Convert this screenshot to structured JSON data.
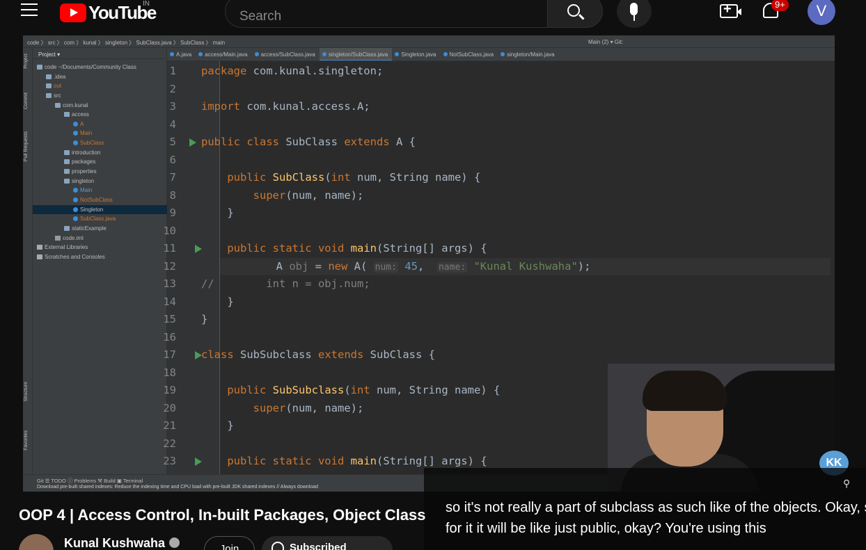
{
  "youtube": {
    "logo": "YouTube",
    "country": "IN",
    "search_placeholder": "Search",
    "notifications_badge": "9+",
    "avatar_letter": "V"
  },
  "ide": {
    "breadcrumb": "code 〉 src 〉 com 〉 kunal 〉 singleton 〉 SubClass.java 〉 SubClass 〉 main",
    "toolbar_right": "Main (2) ▾        Git:",
    "project_label": "Project ▾",
    "tree": [
      {
        "label": "code  ~/Documents/Community Class",
        "depth": 0,
        "type": "folder"
      },
      {
        "label": ".idea",
        "depth": 1,
        "type": "folder"
      },
      {
        "label": "out",
        "depth": 1,
        "type": "folder",
        "color": "#c87832"
      },
      {
        "label": "src",
        "depth": 1,
        "type": "folder"
      },
      {
        "label": "com.kunal",
        "depth": 2,
        "type": "folder"
      },
      {
        "label": "access",
        "depth": 3,
        "type": "folder"
      },
      {
        "label": "A",
        "depth": 4,
        "type": "class",
        "color": "#c87832"
      },
      {
        "label": "Main",
        "depth": 4,
        "type": "class",
        "color": "#c87832"
      },
      {
        "label": "SubClass",
        "depth": 4,
        "type": "class",
        "color": "#c87832"
      },
      {
        "label": "introduction",
        "depth": 3,
        "type": "folder"
      },
      {
        "label": "packages",
        "depth": 3,
        "type": "folder"
      },
      {
        "label": "properties",
        "depth": 3,
        "type": "folder"
      },
      {
        "label": "singleton",
        "depth": 3,
        "type": "folder"
      },
      {
        "label": "Main",
        "depth": 4,
        "type": "class",
        "color": "#6897bb"
      },
      {
        "label": "NotSubClass",
        "depth": 4,
        "type": "class",
        "color": "#c87832"
      },
      {
        "label": "Singleton",
        "depth": 4,
        "type": "class",
        "color": "#bbbbbb",
        "selected": true
      },
      {
        "label": "SubClass.java",
        "depth": 4,
        "type": "class",
        "color": "#c87832"
      },
      {
        "label": "staticExample",
        "depth": 3,
        "type": "folder"
      },
      {
        "label": "code.iml",
        "depth": 2,
        "type": "file"
      },
      {
        "label": "External Libraries",
        "depth": 0,
        "type": "lib"
      },
      {
        "label": "Scratches and Consoles",
        "depth": 0,
        "type": "lib"
      }
    ],
    "tabs": [
      {
        "label": "A.java"
      },
      {
        "label": "access/Main.java"
      },
      {
        "label": "access/SubClass.java"
      },
      {
        "label": "singleton/SubClass.java",
        "active": true
      },
      {
        "label": "Singleton.java"
      },
      {
        "label": "NotSubClass.java"
      },
      {
        "label": "singleton/Main.java"
      }
    ],
    "left_strip": [
      "Project",
      "Commit",
      "Pull Requests",
      "Structure",
      "Favorites"
    ],
    "bottom_tools": "Git     ☰ TODO     ⓘ Problems     ⚒ Build     ▣ Terminal",
    "status_message": "Download pre-built shared indexes: Reduce the indexing time and CPU load with pre-built JDK shared indexes // Always download",
    "code_lines": [
      {
        "n": "1",
        "html": "<span class=\"kw\">package</span> com.kunal.singleton;"
      },
      {
        "n": "2",
        "html": ""
      },
      {
        "n": "3",
        "html": "<span class=\"kw\">import</span> com.kunal.access.A;"
      },
      {
        "n": "4",
        "html": ""
      },
      {
        "n": "5",
        "html": "<span class=\"kw\">public class</span> SubClass <span class=\"kw\">extends</span> A {",
        "run": true
      },
      {
        "n": "6",
        "html": ""
      },
      {
        "n": "7",
        "html": "    <span class=\"kw\">public</span> <span class=\"fn\">SubClass</span>(<span class=\"kw\">int</span> num, String name) {"
      },
      {
        "n": "8",
        "html": "        <span class=\"kw\">super</span>(num, name);"
      },
      {
        "n": "9",
        "html": "    }"
      },
      {
        "n": "10",
        "html": ""
      },
      {
        "n": "11",
        "html": "    <span class=\"kw\">public static void</span> <span class=\"fn\">main</span>(String[] args) {",
        "run": true
      },
      {
        "n": "12",
        "html": "        A <span class=\"dim\">obj</span> = <span class=\"kw\">new</span> A( <span class=\"hint\">num:</span> <span style=\"color:#6897bb\">45</span>,  <span class=\"hint\">name:</span> <span class=\"st\">\"Kunal Kushwaha\"</span>);",
        "current": true
      },
      {
        "n": "13",
        "html": "<span class=\"cm\">//        int n = obj.num;</span>"
      },
      {
        "n": "14",
        "html": "    }"
      },
      {
        "n": "15",
        "html": "}"
      },
      {
        "n": "16",
        "html": ""
      },
      {
        "n": "17",
        "html": "<span class=\"kw\">class</span> SubSubclass <span class=\"kw\">extends</span> SubClass {",
        "run": true
      },
      {
        "n": "18",
        "html": ""
      },
      {
        "n": "19",
        "html": "    <span class=\"kw\">public</span> <span class=\"fn\">SubSubclass</span>(<span class=\"kw\">int</span> num, String name) {"
      },
      {
        "n": "20",
        "html": "        <span class=\"kw\">super</span>(num, name);"
      },
      {
        "n": "21",
        "html": "    }"
      },
      {
        "n": "22",
        "html": ""
      },
      {
        "n": "23",
        "html": "    <span class=\"kw\">public static void</span> <span class=\"fn\">main</span>(String[] args) {",
        "run": true
      }
    ]
  },
  "captions": {
    "line1": "so it's not really a part of subclass as such like of the objects. Okay, so",
    "line2": "for it it will be like just public, okay? You're using this"
  },
  "video": {
    "title": "OOP 4 | Access Control, In-built Packages, Object Class",
    "channel": "Kunal Kushwaha",
    "join_label": "Join",
    "subscribe_label": "Subscribed"
  },
  "colors": {
    "accent": "#ff0000",
    "badge": "#cc0000",
    "ide_bg": "#2b2b2b"
  }
}
